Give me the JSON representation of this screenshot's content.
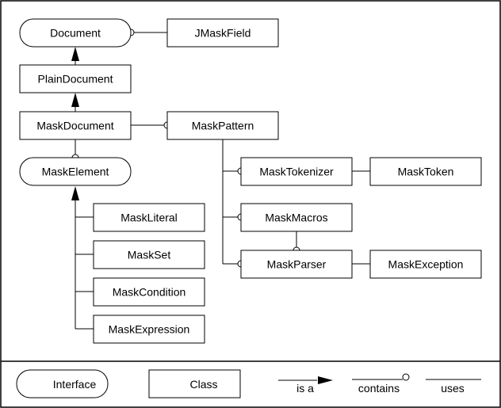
{
  "diagram": {
    "title": "",
    "nodes": [
      {
        "id": "Document",
        "label": "Document",
        "kind": "interface"
      },
      {
        "id": "JMaskField",
        "label": "JMaskField",
        "kind": "class"
      },
      {
        "id": "PlainDocument",
        "label": "PlainDocument",
        "kind": "class"
      },
      {
        "id": "MaskDocument",
        "label": "MaskDocument",
        "kind": "class"
      },
      {
        "id": "MaskPattern",
        "label": "MaskPattern",
        "kind": "class"
      },
      {
        "id": "MaskElement",
        "label": "MaskElement",
        "kind": "interface"
      },
      {
        "id": "MaskTokenizer",
        "label": "MaskTokenizer",
        "kind": "class"
      },
      {
        "id": "MaskToken",
        "label": "MaskToken",
        "kind": "class"
      },
      {
        "id": "MaskMacros",
        "label": "MaskMacros",
        "kind": "class"
      },
      {
        "id": "MaskParser",
        "label": "MaskParser",
        "kind": "class"
      },
      {
        "id": "MaskException",
        "label": "MaskException",
        "kind": "class"
      },
      {
        "id": "MaskLiteral",
        "label": "MaskLiteral",
        "kind": "class"
      },
      {
        "id": "MaskSet",
        "label": "MaskSet",
        "kind": "class"
      },
      {
        "id": "MaskCondition",
        "label": "MaskCondition",
        "kind": "class"
      },
      {
        "id": "MaskExpression",
        "label": "MaskExpression",
        "kind": "class"
      }
    ],
    "edges": [
      {
        "from": "JMaskField",
        "to": "Document",
        "type": "contains"
      },
      {
        "from": "PlainDocument",
        "to": "Document",
        "type": "is a"
      },
      {
        "from": "MaskDocument",
        "to": "PlainDocument",
        "type": "is a"
      },
      {
        "from": "MaskDocument",
        "to": "MaskPattern",
        "type": "contains"
      },
      {
        "from": "MaskDocument",
        "to": "MaskElement",
        "type": "contains"
      },
      {
        "from": "MaskPattern",
        "to": "MaskTokenizer",
        "type": "contains"
      },
      {
        "from": "MaskPattern",
        "to": "MaskMacros",
        "type": "contains"
      },
      {
        "from": "MaskPattern",
        "to": "MaskParser",
        "type": "contains"
      },
      {
        "from": "MaskTokenizer",
        "to": "MaskToken",
        "type": "uses"
      },
      {
        "from": "MaskMacros",
        "to": "MaskParser",
        "type": "contains"
      },
      {
        "from": "MaskParser",
        "to": "MaskException",
        "type": "uses"
      },
      {
        "from": "MaskLiteral",
        "to": "MaskElement",
        "type": "is a"
      },
      {
        "from": "MaskSet",
        "to": "MaskElement",
        "type": "is a"
      },
      {
        "from": "MaskCondition",
        "to": "MaskElement",
        "type": "is a"
      },
      {
        "from": "MaskExpression",
        "to": "MaskElement",
        "type": "is a"
      }
    ]
  },
  "legend": {
    "interface": "Interface",
    "class": "Class",
    "is_a": "is a",
    "contains": "contains",
    "uses": "uses"
  }
}
